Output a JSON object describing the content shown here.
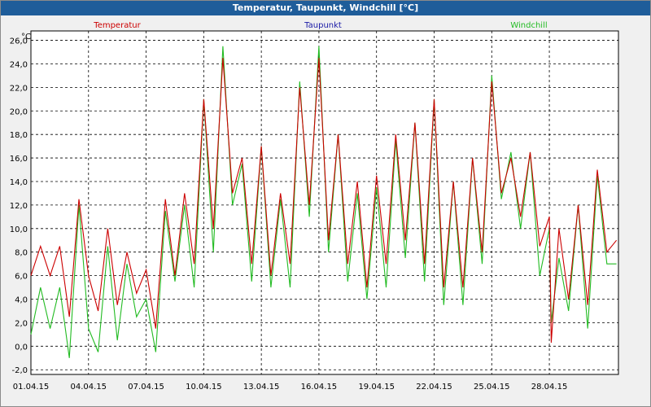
{
  "window": {
    "title": "Temperatur, Taupunkt, Windchill [°C]"
  },
  "colors": {
    "temperatur": "#cc0000",
    "taupunkt": "#1a1aa6",
    "windchill": "#22bb22",
    "grid": "#000000"
  },
  "chart_data": {
    "type": "line",
    "title": "Temperatur, Taupunkt, Windchill [°C]",
    "ylabel": "°C",
    "xlabel": "",
    "ylim": [
      -2.4,
      26.8
    ],
    "xlim": [
      0,
      30.6
    ],
    "yticks": [
      "-2,0",
      "0,0",
      "2,0",
      "4,0",
      "6,0",
      "8,0",
      "10,0",
      "12,0",
      "14,0",
      "16,0",
      "18,0",
      "20,0",
      "22,0",
      "24,0",
      "26,0"
    ],
    "ytick_values": [
      -2,
      0,
      2,
      4,
      6,
      8,
      10,
      12,
      14,
      16,
      18,
      20,
      22,
      24,
      26
    ],
    "xticks": [
      "01.04.15",
      "04.04.15",
      "07.04.15",
      "10.04.15",
      "13.04.15",
      "16.04.15",
      "19.04.15",
      "22.04.15",
      "25.04.15",
      "28.04.15"
    ],
    "xtick_days": [
      0,
      3,
      6,
      9,
      12,
      15,
      18,
      21,
      24,
      27
    ],
    "grid": true,
    "legend": [
      "Temperatur",
      "Taupunkt",
      "Windchill"
    ],
    "series": [
      {
        "name": "Temperatur",
        "x": [
          0,
          0.5,
          1,
          1.5,
          2,
          2.5,
          3,
          3.5,
          4,
          4.5,
          5,
          5.5,
          6,
          6.5,
          7,
          7.5,
          8,
          8.5,
          9,
          9.5,
          10,
          10.5,
          11,
          11.5,
          12,
          12.5,
          13,
          13.5,
          14,
          14.5,
          15,
          15.5,
          16,
          16.5,
          17,
          17.5,
          18,
          18.5,
          19,
          19.5,
          20,
          20.5,
          21,
          21.5,
          22,
          22.5,
          23,
          23.5,
          24,
          24.5,
          25,
          25.5,
          26,
          26.5,
          27,
          27.1,
          27.5,
          28,
          28.5,
          29,
          29.5,
          30,
          30.5
        ],
        "y": [
          6,
          8.5,
          6,
          8.5,
          2.5,
          12.5,
          6,
          3,
          10,
          3.5,
          8,
          4.5,
          6.5,
          1.5,
          12.5,
          6,
          13,
          7,
          21,
          10,
          24.5,
          13,
          16,
          7,
          17,
          6,
          13,
          7,
          22,
          12,
          24.5,
          9,
          18,
          7,
          14,
          5,
          14.5,
          7,
          18,
          9,
          19,
          7,
          21,
          5,
          14,
          5,
          16,
          8,
          22.5,
          13,
          16,
          11,
          16.5,
          8.5,
          11,
          0.3,
          10,
          4,
          12,
          3.5,
          15,
          8,
          9
        ]
      },
      {
        "name": "Windchill",
        "x": [
          0,
          0.5,
          1,
          1.5,
          2,
          2.5,
          3,
          3.5,
          4,
          4.5,
          5,
          5.5,
          6,
          6.5,
          7,
          7.5,
          8,
          8.5,
          9,
          9.5,
          10,
          10.5,
          11,
          11.5,
          12,
          12.5,
          13,
          13.5,
          14,
          14.5,
          15,
          15.5,
          16,
          16.5,
          17,
          17.5,
          18,
          18.5,
          19,
          19.5,
          20,
          20.5,
          21,
          21.5,
          22,
          22.5,
          23,
          23.5,
          24,
          24.5,
          25,
          25.5,
          26,
          26.5,
          27,
          27.1,
          27.5,
          28,
          28.5,
          29,
          29.5,
          30,
          30.5
        ],
        "y": [
          1,
          5,
          1.5,
          5,
          -1,
          12,
          1.5,
          -0.5,
          8.5,
          0.5,
          7,
          2.5,
          4,
          -0.5,
          11.5,
          5.5,
          12,
          5,
          21,
          8,
          25.5,
          12,
          15.5,
          5.5,
          17,
          5,
          12.5,
          5,
          22.5,
          11,
          25.5,
          8,
          18,
          5.5,
          13,
          4,
          13.5,
          5,
          17.5,
          7.5,
          19,
          5.5,
          21,
          3.5,
          14,
          3.5,
          16,
          7,
          23,
          12.5,
          16.5,
          10,
          16.5,
          6,
          10,
          2,
          7.5,
          3,
          12,
          1.5,
          14.5,
          7,
          7
        ]
      }
    ]
  }
}
